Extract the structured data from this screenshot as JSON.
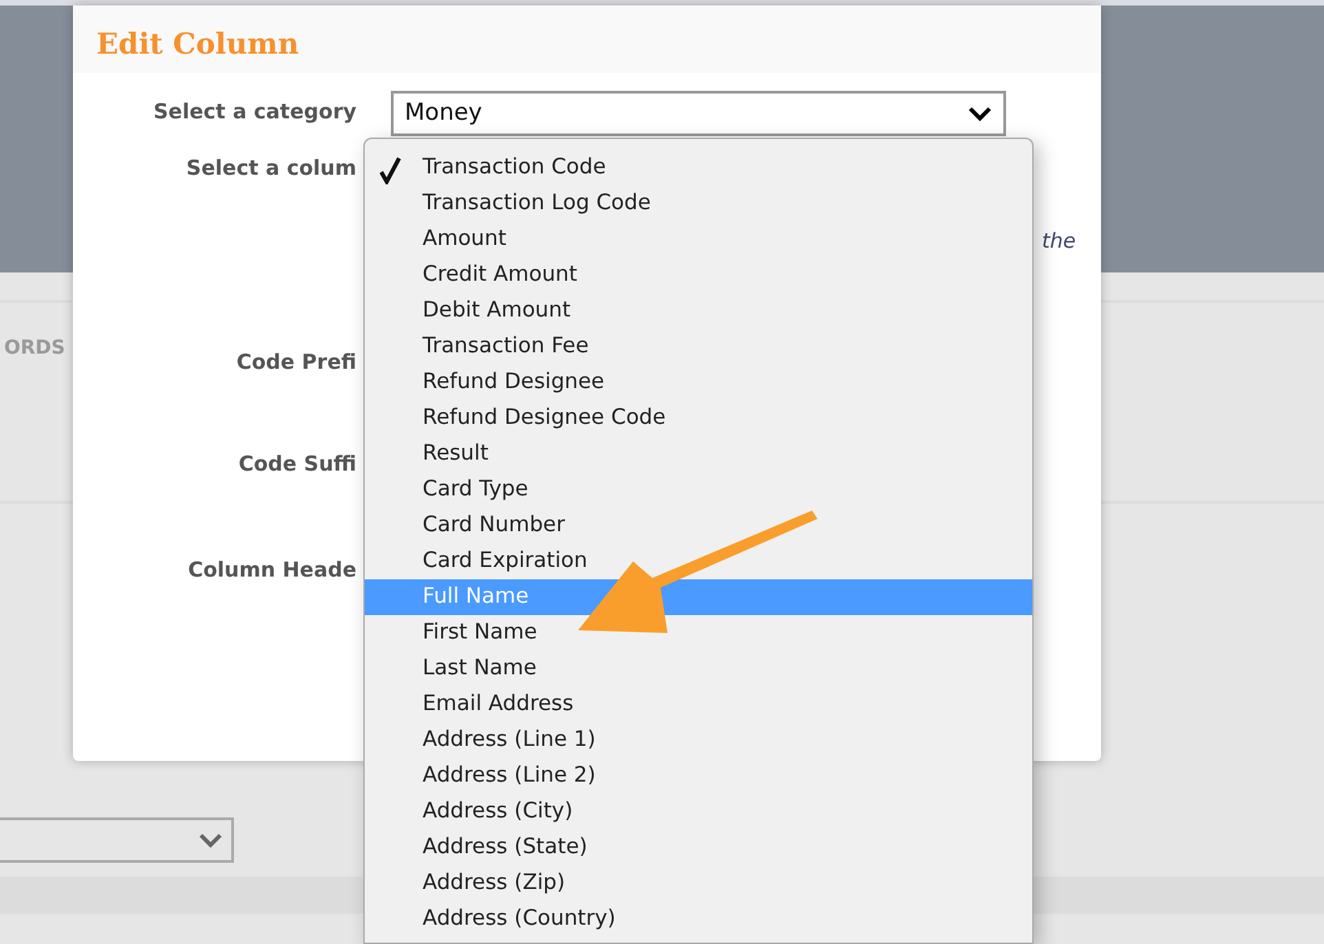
{
  "background": {
    "section_label": "ORDS"
  },
  "dialog": {
    "title": "Edit Column",
    "fields": [
      {
        "label": "Select a category"
      },
      {
        "label": "Select a colum"
      },
      {
        "label": "Code Prefi"
      },
      {
        "label": "Code Suffi"
      },
      {
        "label": "Column Heade"
      }
    ],
    "category_select": {
      "value": "Money"
    },
    "hint": "the"
  },
  "dropdown": {
    "items": [
      {
        "label": "Transaction Code",
        "checked": true,
        "highlighted": false
      },
      {
        "label": "Transaction Log Code",
        "checked": false,
        "highlighted": false
      },
      {
        "label": "Amount",
        "checked": false,
        "highlighted": false
      },
      {
        "label": "Credit Amount",
        "checked": false,
        "highlighted": false
      },
      {
        "label": "Debit Amount",
        "checked": false,
        "highlighted": false
      },
      {
        "label": "Transaction Fee",
        "checked": false,
        "highlighted": false
      },
      {
        "label": "Refund Designee",
        "checked": false,
        "highlighted": false
      },
      {
        "label": "Refund Designee Code",
        "checked": false,
        "highlighted": false
      },
      {
        "label": "Result",
        "checked": false,
        "highlighted": false
      },
      {
        "label": "Card Type",
        "checked": false,
        "highlighted": false
      },
      {
        "label": "Card Number",
        "checked": false,
        "highlighted": false
      },
      {
        "label": "Card Expiration",
        "checked": false,
        "highlighted": false
      },
      {
        "label": "Full Name",
        "checked": false,
        "highlighted": true
      },
      {
        "label": "First Name",
        "checked": false,
        "highlighted": false
      },
      {
        "label": "Last Name",
        "checked": false,
        "highlighted": false
      },
      {
        "label": "Email Address",
        "checked": false,
        "highlighted": false
      },
      {
        "label": "Address (Line 1)",
        "checked": false,
        "highlighted": false
      },
      {
        "label": "Address (Line 2)",
        "checked": false,
        "highlighted": false
      },
      {
        "label": "Address (City)",
        "checked": false,
        "highlighted": false
      },
      {
        "label": "Address (State)",
        "checked": false,
        "highlighted": false
      },
      {
        "label": "Address (Zip)",
        "checked": false,
        "highlighted": false
      },
      {
        "label": "Address (Country)",
        "checked": false,
        "highlighted": false
      }
    ]
  }
}
